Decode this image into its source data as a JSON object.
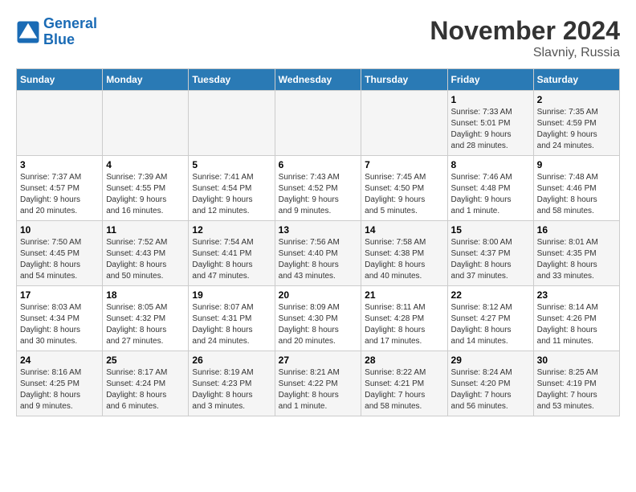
{
  "header": {
    "logo_line1": "General",
    "logo_line2": "Blue",
    "month_title": "November 2024",
    "location": "Slavniy, Russia"
  },
  "weekdays": [
    "Sunday",
    "Monday",
    "Tuesday",
    "Wednesday",
    "Thursday",
    "Friday",
    "Saturday"
  ],
  "weeks": [
    [
      {
        "day": "",
        "info": ""
      },
      {
        "day": "",
        "info": ""
      },
      {
        "day": "",
        "info": ""
      },
      {
        "day": "",
        "info": ""
      },
      {
        "day": "",
        "info": ""
      },
      {
        "day": "1",
        "info": "Sunrise: 7:33 AM\nSunset: 5:01 PM\nDaylight: 9 hours\nand 28 minutes."
      },
      {
        "day": "2",
        "info": "Sunrise: 7:35 AM\nSunset: 4:59 PM\nDaylight: 9 hours\nand 24 minutes."
      }
    ],
    [
      {
        "day": "3",
        "info": "Sunrise: 7:37 AM\nSunset: 4:57 PM\nDaylight: 9 hours\nand 20 minutes."
      },
      {
        "day": "4",
        "info": "Sunrise: 7:39 AM\nSunset: 4:55 PM\nDaylight: 9 hours\nand 16 minutes."
      },
      {
        "day": "5",
        "info": "Sunrise: 7:41 AM\nSunset: 4:54 PM\nDaylight: 9 hours\nand 12 minutes."
      },
      {
        "day": "6",
        "info": "Sunrise: 7:43 AM\nSunset: 4:52 PM\nDaylight: 9 hours\nand 9 minutes."
      },
      {
        "day": "7",
        "info": "Sunrise: 7:45 AM\nSunset: 4:50 PM\nDaylight: 9 hours\nand 5 minutes."
      },
      {
        "day": "8",
        "info": "Sunrise: 7:46 AM\nSunset: 4:48 PM\nDaylight: 9 hours\nand 1 minute."
      },
      {
        "day": "9",
        "info": "Sunrise: 7:48 AM\nSunset: 4:46 PM\nDaylight: 8 hours\nand 58 minutes."
      }
    ],
    [
      {
        "day": "10",
        "info": "Sunrise: 7:50 AM\nSunset: 4:45 PM\nDaylight: 8 hours\nand 54 minutes."
      },
      {
        "day": "11",
        "info": "Sunrise: 7:52 AM\nSunset: 4:43 PM\nDaylight: 8 hours\nand 50 minutes."
      },
      {
        "day": "12",
        "info": "Sunrise: 7:54 AM\nSunset: 4:41 PM\nDaylight: 8 hours\nand 47 minutes."
      },
      {
        "day": "13",
        "info": "Sunrise: 7:56 AM\nSunset: 4:40 PM\nDaylight: 8 hours\nand 43 minutes."
      },
      {
        "day": "14",
        "info": "Sunrise: 7:58 AM\nSunset: 4:38 PM\nDaylight: 8 hours\nand 40 minutes."
      },
      {
        "day": "15",
        "info": "Sunrise: 8:00 AM\nSunset: 4:37 PM\nDaylight: 8 hours\nand 37 minutes."
      },
      {
        "day": "16",
        "info": "Sunrise: 8:01 AM\nSunset: 4:35 PM\nDaylight: 8 hours\nand 33 minutes."
      }
    ],
    [
      {
        "day": "17",
        "info": "Sunrise: 8:03 AM\nSunset: 4:34 PM\nDaylight: 8 hours\nand 30 minutes."
      },
      {
        "day": "18",
        "info": "Sunrise: 8:05 AM\nSunset: 4:32 PM\nDaylight: 8 hours\nand 27 minutes."
      },
      {
        "day": "19",
        "info": "Sunrise: 8:07 AM\nSunset: 4:31 PM\nDaylight: 8 hours\nand 24 minutes."
      },
      {
        "day": "20",
        "info": "Sunrise: 8:09 AM\nSunset: 4:30 PM\nDaylight: 8 hours\nand 20 minutes."
      },
      {
        "day": "21",
        "info": "Sunrise: 8:11 AM\nSunset: 4:28 PM\nDaylight: 8 hours\nand 17 minutes."
      },
      {
        "day": "22",
        "info": "Sunrise: 8:12 AM\nSunset: 4:27 PM\nDaylight: 8 hours\nand 14 minutes."
      },
      {
        "day": "23",
        "info": "Sunrise: 8:14 AM\nSunset: 4:26 PM\nDaylight: 8 hours\nand 11 minutes."
      }
    ],
    [
      {
        "day": "24",
        "info": "Sunrise: 8:16 AM\nSunset: 4:25 PM\nDaylight: 8 hours\nand 9 minutes."
      },
      {
        "day": "25",
        "info": "Sunrise: 8:17 AM\nSunset: 4:24 PM\nDaylight: 8 hours\nand 6 minutes."
      },
      {
        "day": "26",
        "info": "Sunrise: 8:19 AM\nSunset: 4:23 PM\nDaylight: 8 hours\nand 3 minutes."
      },
      {
        "day": "27",
        "info": "Sunrise: 8:21 AM\nSunset: 4:22 PM\nDaylight: 8 hours\nand 1 minute."
      },
      {
        "day": "28",
        "info": "Sunrise: 8:22 AM\nSunset: 4:21 PM\nDaylight: 7 hours\nand 58 minutes."
      },
      {
        "day": "29",
        "info": "Sunrise: 8:24 AM\nSunset: 4:20 PM\nDaylight: 7 hours\nand 56 minutes."
      },
      {
        "day": "30",
        "info": "Sunrise: 8:25 AM\nSunset: 4:19 PM\nDaylight: 7 hours\nand 53 minutes."
      }
    ]
  ]
}
